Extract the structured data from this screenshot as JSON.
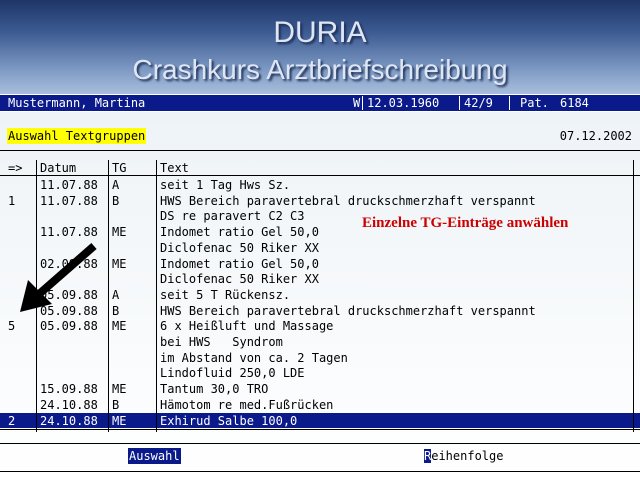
{
  "slide": {
    "title": "DURIA",
    "subtitle": "Crashkurs Arztbriefschreibung"
  },
  "patient": {
    "name": "Mustermann, Martina",
    "sex": "W",
    "birthdate": "12.03.1960",
    "age": "42/9",
    "pat_label": "Pat.",
    "pat_number": "6184"
  },
  "screen": {
    "title": "Auswahl Textgruppen",
    "date": "07.12.2002"
  },
  "table": {
    "headers": [
      "=>",
      "Datum",
      "TG",
      "Text"
    ],
    "rows": [
      {
        "sel": "",
        "date": "11.07.88",
        "tg": "A",
        "text": "seit 1 Tag Hws Sz."
      },
      {
        "sel": "1",
        "date": "11.07.88",
        "tg": "B",
        "text": "HWS Bereich paravertebral druckschmerzhaft verspannt"
      },
      {
        "sel": "",
        "date": "",
        "tg": "",
        "text": "DS re paravert C2 C3"
      },
      {
        "sel": "",
        "date": "11.07.88",
        "tg": "ME",
        "text": "Indomet ratio Gel 50,0"
      },
      {
        "sel": "",
        "date": "",
        "tg": "",
        "text": "Diclofenac 50 Riker XX"
      },
      {
        "sel": "",
        "date": "02.09.88",
        "tg": "ME",
        "text": "Indomet ratio Gel 50,0"
      },
      {
        "sel": "",
        "date": "",
        "tg": "",
        "text": "Diclofenac 50 Riker XX"
      },
      {
        "sel": "",
        "date": "05.09.88",
        "tg": "A",
        "text": "seit 5 T Rückensz."
      },
      {
        "sel": "",
        "date": "05.09.88",
        "tg": "B",
        "text": "HWS Bereich paravertebral druckschmerzhaft verspannt"
      },
      {
        "sel": "5",
        "date": "05.09.88",
        "tg": "ME",
        "text": "6 x Heißluft und Massage"
      },
      {
        "sel": "",
        "date": "",
        "tg": "",
        "text": "bei HWS   Syndrom"
      },
      {
        "sel": "",
        "date": "",
        "tg": "",
        "text": "im Abstand von ca. 2 Tagen"
      },
      {
        "sel": "",
        "date": "",
        "tg": "",
        "text": "Lindofluid 250,0 LDE"
      },
      {
        "sel": "",
        "date": "15.09.88",
        "tg": "ME",
        "text": "Tantum 30,0 TRO"
      },
      {
        "sel": "",
        "date": "24.10.88",
        "tg": "B",
        "text": "Hämotom re med.Fußrücken"
      },
      {
        "sel": "2",
        "date": "24.10.88",
        "tg": "ME",
        "text": "Exhirud Salbe 100,0",
        "selected": true
      }
    ]
  },
  "callout": "Einzelne TG-Einträge anwählen",
  "footer": {
    "auswahl": "Auswahl",
    "reihenfolge_hotkey": "R",
    "reihenfolge_rest": "eihenfolge"
  },
  "colors": {
    "bar_blue": "#0b1a8a",
    "highlight_yellow": "#ffff00",
    "callout_red": "#cc0000"
  }
}
